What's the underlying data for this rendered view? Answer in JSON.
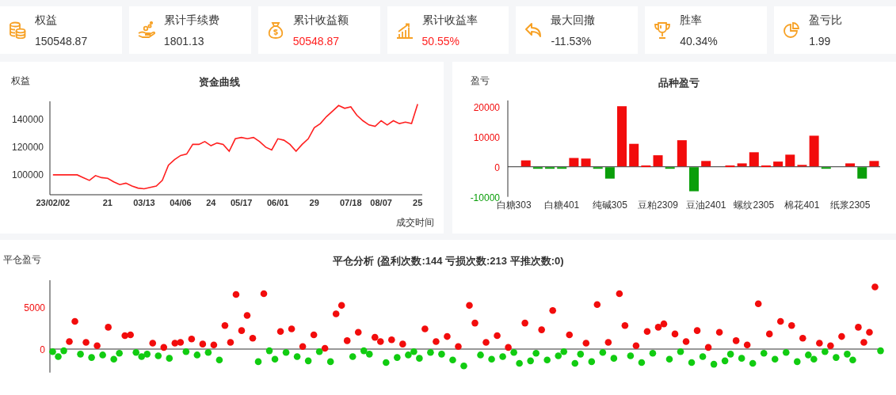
{
  "stats": [
    {
      "label": "权益",
      "value": "150548.87",
      "color": "#333333"
    },
    {
      "label": "累计手续费",
      "value": "1801.13",
      "color": "#333333"
    },
    {
      "label": "累计收益额",
      "value": "50548.87",
      "color": "#ff1f1f"
    },
    {
      "label": "累计收益率",
      "value": "50.55%",
      "color": "#ff1f1f"
    },
    {
      "label": "最大回撤",
      "value": "-11.53%",
      "color": "#333333"
    },
    {
      "label": "胜率",
      "value": "40.34%",
      "color": "#333333"
    },
    {
      "label": "盈亏比",
      "value": "1.99",
      "color": "#333333"
    }
  ],
  "equity_panel": {
    "axis_label": "权益",
    "chart_data": {
      "type": "line",
      "title": "资金曲线",
      "xlabel": "成交时间",
      "ylim": [
        85700,
        153000
      ],
      "yticks": [
        100000,
        120000,
        140000
      ],
      "categories": [
        "23/02/02",
        null,
        null,
        null,
        null,
        null,
        null,
        null,
        null,
        "21",
        null,
        null,
        null,
        null,
        null,
        "03/13",
        null,
        null,
        null,
        null,
        null,
        "04/06",
        null,
        null,
        null,
        null,
        "24",
        null,
        null,
        null,
        null,
        "05/17",
        null,
        null,
        null,
        null,
        null,
        "06/01",
        null,
        null,
        null,
        null,
        null,
        "29",
        null,
        null,
        null,
        null,
        null,
        "07/18",
        null,
        null,
        null,
        null,
        "08/07",
        null,
        null,
        null,
        null,
        null,
        "25"
      ],
      "series": [
        {
          "color": "#ff2020",
          "values": [
            100000,
            100000,
            100000,
            100000,
            100000,
            98000,
            96000,
            99500,
            98000,
            97500,
            95000,
            93000,
            94000,
            92000,
            90500,
            90000,
            91000,
            92000,
            96000,
            107000,
            111000,
            114000,
            115000,
            122000,
            122000,
            124000,
            121000,
            123000,
            122000,
            117000,
            126000,
            127000,
            126000,
            127000,
            124000,
            120000,
            118000,
            126000,
            125000,
            122000,
            117000,
            122000,
            126000,
            134000,
            137000,
            142000,
            146000,
            150000,
            148000,
            149000,
            143000,
            139000,
            136000,
            135000,
            139000,
            136000,
            139000,
            137000,
            138000,
            137000,
            151000
          ]
        }
      ]
    }
  },
  "product_panel": {
    "axis_label": "盈亏",
    "chart_data": {
      "type": "bar",
      "title": "品种盈亏",
      "ylim": [
        -10000,
        21000
      ],
      "yticks": [
        -10000,
        0,
        10000,
        20000
      ],
      "categories": [
        "白糖303",
        null,
        null,
        null,
        "白糖401",
        null,
        null,
        null,
        "纯碱305",
        null,
        null,
        null,
        "豆粕2309",
        null,
        null,
        null,
        "豆油2401",
        null,
        null,
        null,
        "螺纹2305",
        null,
        null,
        null,
        "棉花401",
        null,
        null,
        null,
        "纸浆2305",
        null,
        null
      ],
      "series": [
        {
          "color": "#f20c0c",
          "values": [
            null,
            2000,
            null,
            null,
            null,
            2800,
            2600,
            null,
            null,
            20000,
            7500,
            300,
            3700,
            null,
            8700,
            null,
            1800,
            null,
            300,
            1000,
            4700,
            300,
            1600,
            3900,
            500,
            10200,
            null,
            null,
            1000,
            null,
            1800
          ]
        },
        {
          "color": "#0a9e0a",
          "values": [
            null,
            null,
            -500,
            -300,
            -500,
            null,
            null,
            -300,
            -3800,
            null,
            null,
            null,
            null,
            -300,
            null,
            -8000,
            null,
            null,
            null,
            null,
            null,
            null,
            null,
            null,
            null,
            null,
            -300,
            null,
            null,
            -3800,
            null
          ]
        }
      ]
    }
  },
  "close_panel": {
    "axis_label": "平仓盈亏",
    "chart_data": {
      "type": "scatter",
      "title": "平仓分析 (盈利次数:144 亏损次数:213 平推次数:0)",
      "ylim": [
        -2800,
        8200
      ],
      "yticks": [
        0,
        5000
      ],
      "series": [
        {
          "color": "#f20c0c",
          "values": [
            null,
            null,
            null,
            900,
            3300,
            null,
            800,
            null,
            400,
            null,
            2600,
            null,
            null,
            1600,
            1700,
            null,
            null,
            null,
            700,
            null,
            200,
            null,
            700,
            800,
            null,
            1200,
            null,
            600,
            null,
            500,
            null,
            2800,
            800,
            6500,
            2200,
            4000,
            1300,
            null,
            6600,
            null,
            null,
            2100,
            null,
            2400,
            null,
            300,
            null,
            1700,
            null,
            100,
            null,
            4200,
            5200,
            1000,
            null,
            2000,
            null,
            null,
            1400,
            900,
            null,
            1100,
            null,
            600,
            null,
            null,
            null,
            2400,
            null,
            900,
            null,
            1500,
            null,
            300,
            null,
            5200,
            3100,
            null,
            800,
            null,
            1600,
            null,
            200,
            null,
            null,
            3100,
            null,
            null,
            2300,
            null,
            4600,
            null,
            null,
            1700,
            null,
            null,
            700,
            null,
            5300,
            null,
            800,
            null,
            6600,
            2800,
            null,
            400,
            null,
            2100,
            null,
            2600,
            3000,
            null,
            1800,
            null,
            900,
            null,
            2200,
            null,
            200,
            null,
            2000,
            null,
            null,
            1000,
            null,
            500,
            null,
            5400,
            null,
            1800,
            null,
            3300,
            null,
            2800,
            null,
            1300,
            null,
            null,
            700,
            null,
            400,
            null,
            1500,
            null,
            null,
            2600,
            800,
            2000,
            7400,
            null
          ]
        },
        {
          "color": "#11cc11",
          "values": [
            -300,
            -900,
            -200,
            null,
            null,
            -600,
            null,
            -1000,
            null,
            -700,
            null,
            -1200,
            -500,
            null,
            null,
            -400,
            -900,
            -600,
            null,
            -800,
            null,
            -1100,
            null,
            null,
            -300,
            null,
            -700,
            null,
            -400,
            null,
            -1300,
            null,
            null,
            null,
            null,
            null,
            null,
            -1500,
            null,
            -200,
            -1200,
            null,
            -400,
            null,
            -900,
            null,
            -1400,
            null,
            -300,
            null,
            -1500,
            null,
            null,
            null,
            -900,
            null,
            -200,
            -600,
            null,
            null,
            -1600,
            null,
            -1000,
            null,
            -700,
            -300,
            -1100,
            null,
            -400,
            null,
            -600,
            null,
            -1300,
            null,
            -2000,
            null,
            null,
            -700,
            null,
            -1200,
            null,
            -900,
            null,
            -400,
            -1700,
            null,
            -1400,
            -500,
            null,
            -1300,
            null,
            -800,
            -300,
            null,
            -1700,
            -600,
            null,
            -1500,
            null,
            -400,
            null,
            -1100,
            null,
            null,
            -800,
            null,
            -1600,
            null,
            -500,
            null,
            null,
            -1200,
            null,
            -300,
            null,
            -1600,
            null,
            -900,
            null,
            -1800,
            null,
            -1400,
            -600,
            null,
            -1100,
            null,
            -1700,
            null,
            -500,
            null,
            -1200,
            null,
            -400,
            null,
            -1500,
            null,
            -700,
            -1200,
            null,
            -300,
            null,
            -1000,
            null,
            -600,
            -1300,
            null,
            null,
            null,
            null,
            -200
          ]
        }
      ]
    }
  }
}
